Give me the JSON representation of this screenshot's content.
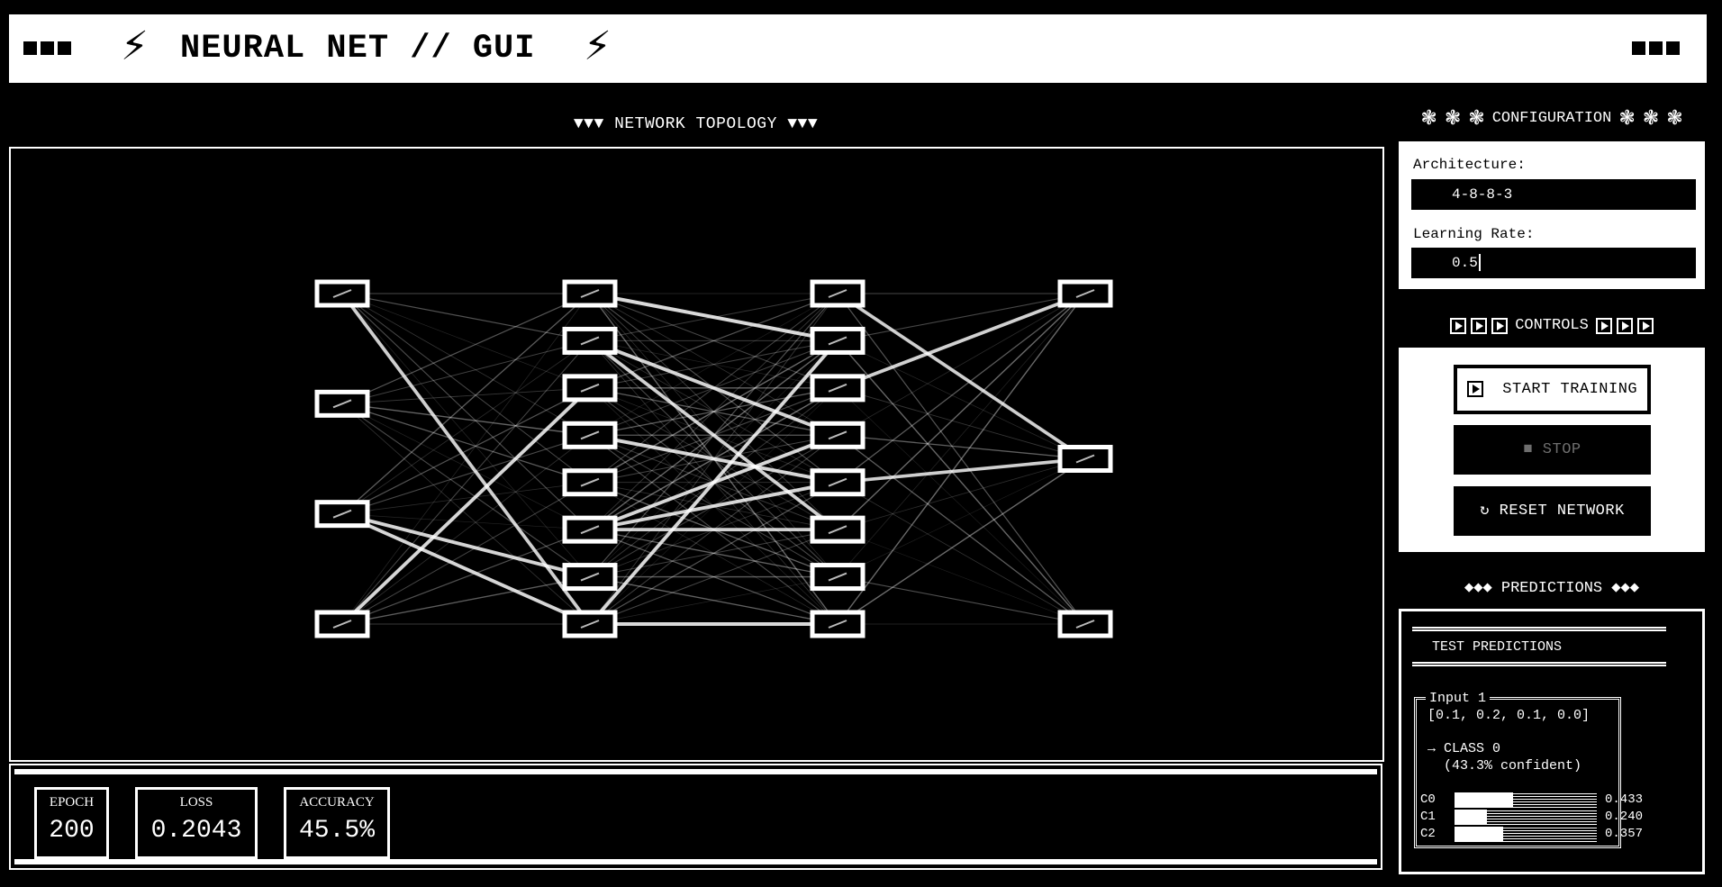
{
  "header": {
    "title": "NEURAL NET // GUI",
    "bolt_glyph": "⚡"
  },
  "topology": {
    "title": "▼▼▼ NETWORK TOPOLOGY ▼▼▼",
    "architecture": [
      4,
      8,
      8,
      3
    ]
  },
  "stats": {
    "epoch_label": "EPOCH",
    "epoch": "200",
    "loss_label": "LOSS",
    "loss": "0.2043",
    "accuracy_label": "ACCURACY",
    "accuracy": "45.5%"
  },
  "config": {
    "title": "CONFIGURATION",
    "gear_glyph": "❃",
    "architecture_label": "Architecture:",
    "architecture_value": "4-8-8-3",
    "lr_label": "Learning Rate:",
    "lr_value": "0.5"
  },
  "controls": {
    "title": "CONTROLS",
    "start_label": "START TRAINING",
    "stop_label": "■ STOP",
    "reset_label": "↻ RESET NETWORK"
  },
  "predictions": {
    "title": "◆◆◆ PREDICTIONS ◆◆◆",
    "heading": "TEST PREDICTIONS",
    "input_title": "Input 1",
    "input_vector": "[0.1, 0.2, 0.1, 0.0]",
    "predicted": "→ CLASS 0",
    "confidence": "(43.3% confident)",
    "classes": [
      {
        "label": "C0",
        "value": 0.433,
        "value_text": "0.433"
      },
      {
        "label": "C1",
        "value": 0.24,
        "value_text": "0.240"
      },
      {
        "label": "C2",
        "value": 0.357,
        "value_text": "0.357"
      }
    ]
  },
  "colors": {
    "background": "#000000",
    "foreground": "#ffffff",
    "disabled_text": "#6e6e6e"
  }
}
